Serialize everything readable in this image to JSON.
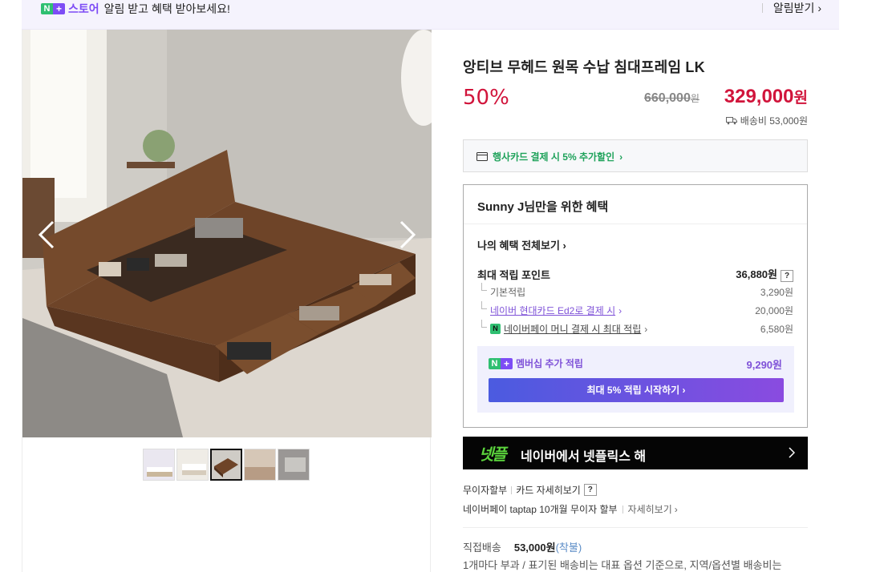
{
  "topbar": {
    "badge_n": "N",
    "badge_plus": "+",
    "store_label": "스토어",
    "message": "알림 받고 혜택 받아보세요!",
    "alert_label": "알림받기",
    "alert_chevron": "›"
  },
  "gallery": {
    "prev_icon": "chevron-left-icon",
    "next_icon": "chevron-right-icon",
    "thumbnail_count": 5,
    "selected_index": 2
  },
  "product": {
    "title": "앙티브 무헤드 원목 수납 침대프레임 LK",
    "discount": "50%",
    "original_price": "660,000",
    "original_unit": "원",
    "price": "329,000",
    "price_unit": "원",
    "shipping": "배송비 53,000원"
  },
  "card_promo": {
    "text": "행사카드 결제 시 5% 추가할인",
    "chevron": "›"
  },
  "benefit": {
    "title": "Sunny J님만을 위한 혜택",
    "view_all": "나의 혜택 전체보기",
    "view_all_chevron": "›",
    "max_points_label": "최대 적립 포인트",
    "max_points_value": "36,880원",
    "help": "?",
    "rows": [
      {
        "label": "기본적립",
        "value": "3,290원"
      },
      {
        "label": "네이버 현대카드 Ed2로 결제 시",
        "value": "20,000원"
      },
      {
        "label": "네이버페이 머니 결제 시 최대 적립",
        "value": "6,580원"
      }
    ],
    "membership_label": "멤버십 추가 적립",
    "membership_value": "9,290원",
    "start_button": "최대 5% 적립 시작하기",
    "start_chevron": "›"
  },
  "banner": {
    "logo": "넷플",
    "text": "네이버에서 넷플릭스 해"
  },
  "installment": {
    "label": "무이자할부",
    "card_detail": "카드 자세히보기",
    "help": "?",
    "taptap": "네이버페이 taptap 10개월 무이자 할부",
    "detail": "자세히보기",
    "detail_chevron": "›"
  },
  "delivery": {
    "label": "직접배송",
    "fee": "53,000원",
    "type": "(착불)",
    "note": "1개마다 부과 / 표기된 배송비는 대표 옵션 기준으로, 지역/옵션별 배송비는"
  },
  "colors": {
    "price_red": "#d1143b",
    "naver_green": "#2fbf71",
    "plus_purple": "#7d4cf5"
  }
}
